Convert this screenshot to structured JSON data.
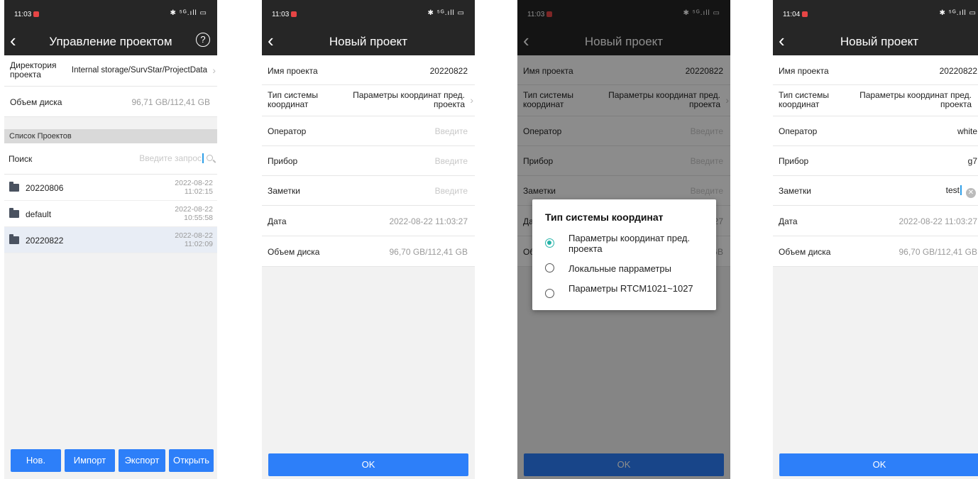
{
  "colors": {
    "accent": "#2d7ff9",
    "header": "#262626",
    "radio_selected": "#26b3a8"
  },
  "screen1": {
    "status_time": "11:03",
    "status_icons": "✱ ⁵ᴳ.ıll ▭",
    "title": "Управление проектом",
    "help_icon": "?",
    "directory_label": "Директория проекта",
    "directory_value": "Internal storage/SurvStar/ProjectData",
    "disk_label": "Объем диска",
    "disk_value": "96,71 GB/112,41 GB",
    "section_title": "Список Проектов",
    "search_label": "Поиск",
    "search_placeholder": "Введите запрос",
    "projects": [
      {
        "name": "20220806",
        "date": "2022-08-22",
        "time": "11:02:15"
      },
      {
        "name": "default",
        "date": "2022-08-22",
        "time": "10:55:58"
      },
      {
        "name": "20220822",
        "date": "2022-08-22",
        "time": "11:02:09"
      }
    ],
    "buttons": {
      "new": "Нов.",
      "import": "Импорт",
      "export": "Экспорт",
      "open": "Открыть"
    }
  },
  "screen2": {
    "status_time": "11:03",
    "status_icons": "✱ ⁵ᴳ.ıll ▭",
    "title": "Новый проект",
    "name_label": "Имя проекта",
    "name_value": "20220822",
    "coord_label": "Тип системы координат",
    "coord_value": "Параметры координат пред. проекта",
    "operator_label": "Оператор",
    "operator_placeholder": "Введите",
    "device_label": "Прибор",
    "device_placeholder": "Введите",
    "notes_label": "Заметки",
    "notes_placeholder": "Введите",
    "date_label": "Дата",
    "date_value": "2022-08-22 11:03:27",
    "disk_label": "Объем диска",
    "disk_value": "96,70 GB/112,41 GB",
    "ok": "OK"
  },
  "screen3": {
    "status_time": "11:03",
    "status_icons": "✱ ⁵ᴳ.ıll ▭",
    "title": "Новый проект",
    "name_label": "Имя проекта",
    "name_value": "20220822",
    "coord_label": "Тип системы координат",
    "coord_value": "Параметры координат пред. проекта",
    "operator_label": "Оператор",
    "operator_placeholder": "Введите",
    "device_label": "Прибор",
    "device_placeholder": "Введите",
    "notes_label": "Заметки",
    "notes_placeholder": "Введите",
    "date_label_partial": "Да",
    "date_value_partial": "27",
    "disk_label_partial": "Об",
    "disk_value_partial": "GB",
    "dialog": {
      "title": "Тип системы координат",
      "options": [
        {
          "label": "Параметры координат пред. проекта",
          "selected": true
        },
        {
          "label": "Локальные парраметры",
          "selected": false
        },
        {
          "label": "Параметры RTCM1021~1027",
          "selected": false
        }
      ]
    },
    "ok": "OK"
  },
  "screen4": {
    "status_time": "11:04",
    "status_icons": "✱ ⁵ᴳ.ıll ▭",
    "title": "Новый проект",
    "name_label": "Имя проекта",
    "name_value": "20220822",
    "coord_label": "Тип системы координат",
    "coord_value": "Параметры координат пред. проекта",
    "operator_label": "Оператор",
    "operator_value": "white",
    "device_label": "Прибор",
    "device_value": "g7",
    "notes_label": "Заметки",
    "notes_value": "test",
    "date_label": "Дата",
    "date_value": "2022-08-22 11:03:27",
    "disk_label": "Объем диска",
    "disk_value": "96,70 GB/112,41 GB",
    "ok": "OK"
  }
}
